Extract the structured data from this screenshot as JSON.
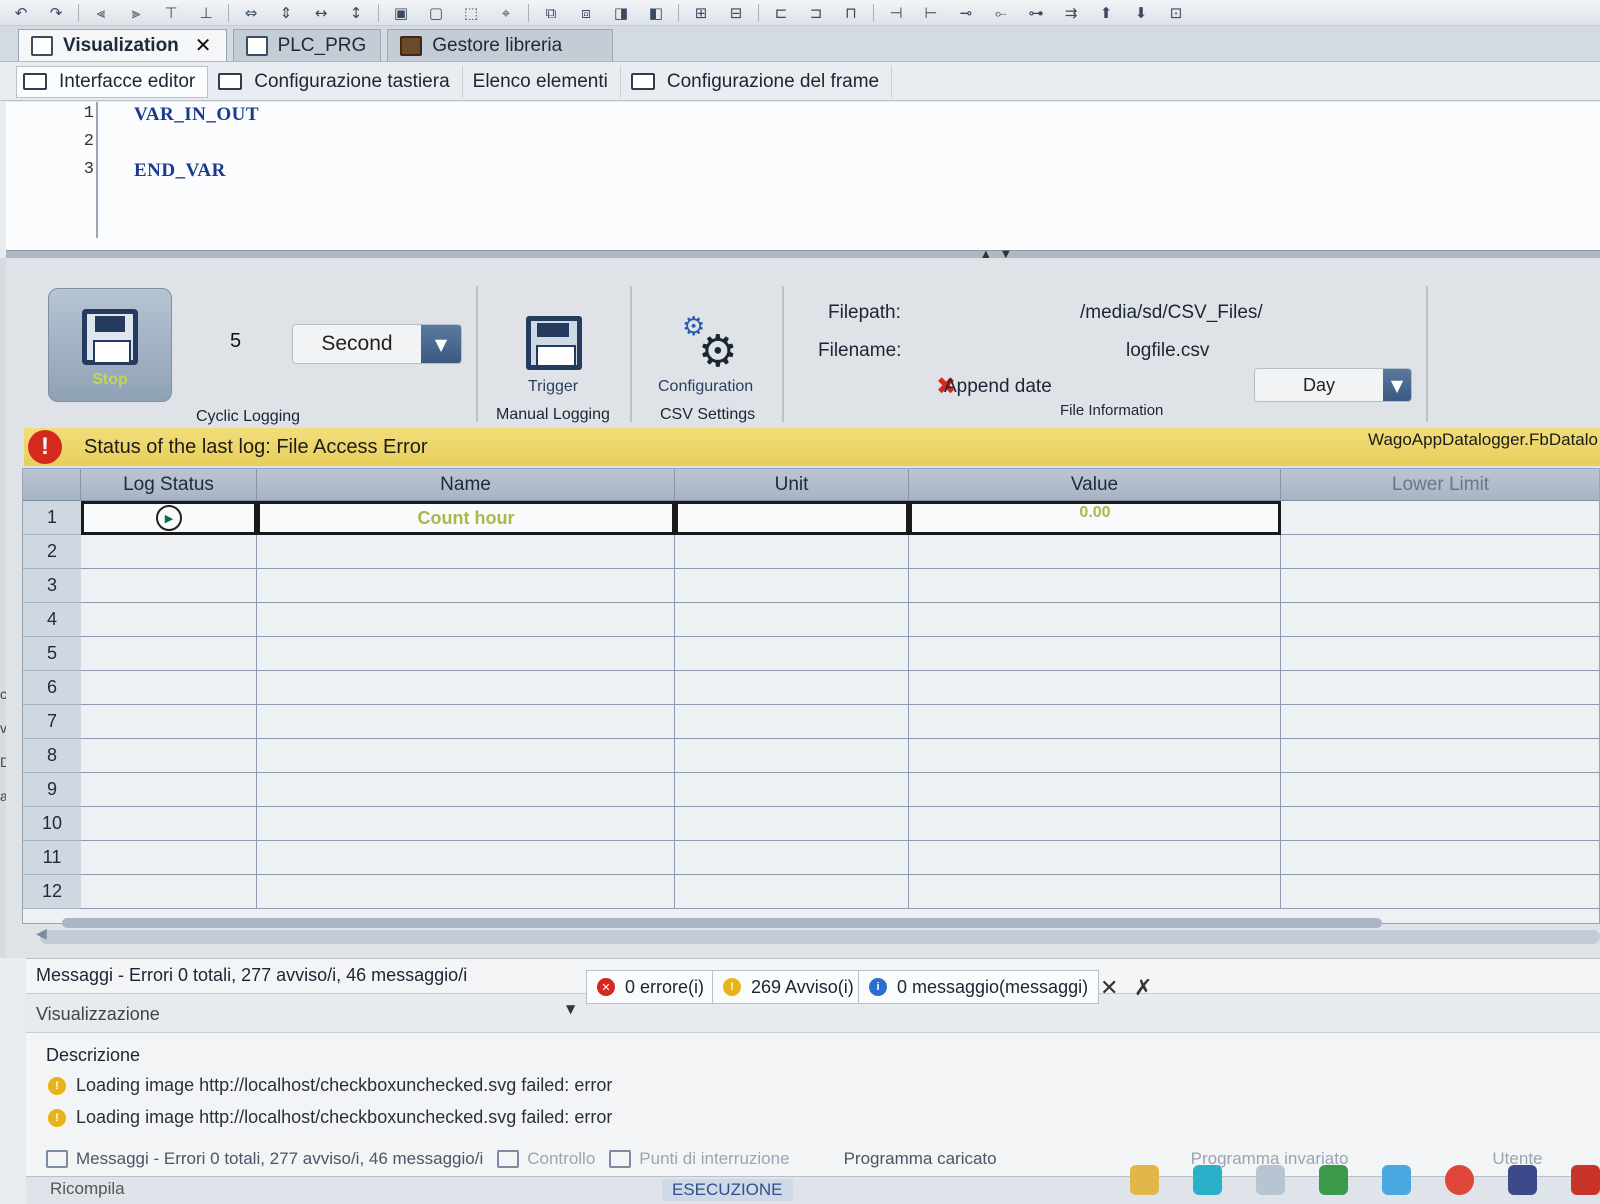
{
  "doc_tabs": [
    {
      "label": "Visualization",
      "close": "✕"
    },
    {
      "label": "PLC_PRG"
    },
    {
      "label": "Gestore libreria"
    }
  ],
  "sub_tabs": [
    {
      "label": "Interfacce editor"
    },
    {
      "label": "Configurazione tastiera"
    },
    {
      "label": "Elenco elementi"
    },
    {
      "label": "Configurazione del frame"
    }
  ],
  "code": {
    "lines": [
      {
        "num": "1",
        "text": "VAR_IN_OUT"
      },
      {
        "num": "2",
        "text": ""
      },
      {
        "num": "3",
        "text": "END_VAR"
      }
    ]
  },
  "cyclic_logging": {
    "stop_label": "Stop",
    "interval_value": "5",
    "unit_selected": "Second",
    "group_label": "Cyclic Logging"
  },
  "manual_logging": {
    "trigger_label": "Trigger",
    "group_label": "Manual Logging"
  },
  "csv_settings": {
    "config_label": "Configuration",
    "group_label": "CSV Settings"
  },
  "file_info": {
    "filepath_label": "Filepath:",
    "filepath_value": "/media/sd/CSV_Files/",
    "filename_label": "Filename:",
    "filename_value": "logfile.csv",
    "append_label": "Append date",
    "append_selected": "Day",
    "group_label": "File Information"
  },
  "status": {
    "text": "Status of the last log: File Access Error",
    "component": "WagoAppDatalogger.FbDatalo",
    "icon": "!"
  },
  "table": {
    "headers": [
      "Log Status",
      "Name",
      "Unit",
      "Value",
      "Lower Limit"
    ],
    "rows": [
      "1",
      "2",
      "3",
      "4",
      "5",
      "6",
      "7",
      "8",
      "9",
      "10",
      "11",
      "12"
    ],
    "row1": {
      "name": "Count hour",
      "value": "0.00"
    }
  },
  "messages": {
    "header": "Messaggi - Errori 0 totali, 277 avviso/i, 46 messaggio/i",
    "filter": "Visualizzazione",
    "errors": "0 errore(i)",
    "warnings": "269 Avviso(i)",
    "infos": "0 messaggio(messaggi)",
    "description_header": "Descrizione",
    "lines": [
      "Loading image http://localhost/checkboxunchecked.svg failed: error",
      "Loading image http://localhost/checkboxunchecked.svg failed: error"
    ]
  },
  "bottom_bar": {
    "messages_tab": "Messaggi - Errori 0 totali, 277 avviso/i, 46 messaggio/i",
    "controllo": "Controllo",
    "breakpoints": "Punti di interruzione",
    "program_loaded": "Programma caricato",
    "program_unchanged": "Programma invariato",
    "user": "Utente",
    "run_state": "ESECUZIONE",
    "compile": "Ricompila"
  },
  "colors": {
    "status_bar": "#e8cf5a",
    "error_red": "#d42a1e",
    "accent_blue": "#3a5a82"
  }
}
